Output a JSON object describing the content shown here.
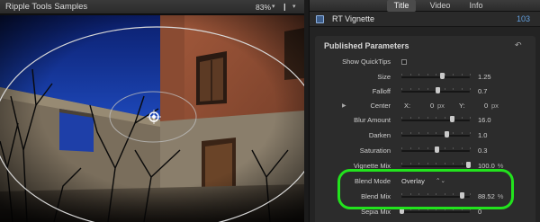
{
  "viewer": {
    "title": "Ripple Tools Samples",
    "zoom": "83%",
    "zoom_arrow": "▾",
    "view_icon": "❙",
    "view_arrow": "▾"
  },
  "inspector": {
    "tabs": [
      {
        "label": "Title",
        "active": true
      },
      {
        "label": "Video",
        "active": false
      },
      {
        "label": "Info",
        "active": false
      }
    ],
    "effect_icon": "filter-icon",
    "effect_name": "RT Vignette",
    "effect_count": "103",
    "section_title": "Published Parameters",
    "reset_icon": "reset-icon",
    "reset_glyph": "↶",
    "params": {
      "show_quicktips": {
        "label": "Show QuickTips",
        "checked": false
      },
      "size": {
        "label": "Size",
        "value": "1.25",
        "fraction": 0.59
      },
      "falloff": {
        "label": "Falloff",
        "value": "0.7",
        "fraction": 0.52
      },
      "center": {
        "label": "Center",
        "x_label": "X:",
        "x_value": "0",
        "x_unit": "px",
        "y_label": "Y:",
        "y_value": "0",
        "y_unit": "px",
        "disclosure": "▶"
      },
      "blur_amount": {
        "label": "Blur Amount",
        "value": "16.0",
        "fraction": 0.74
      },
      "darken": {
        "label": "Darken",
        "value": "1.0",
        "fraction": 0.66
      },
      "saturation": {
        "label": "Saturation",
        "value": "0.3",
        "fraction": 0.51
      },
      "vignette_mix": {
        "label": "Vignette Mix",
        "value": "100.0",
        "unit": "%",
        "fraction": 0.98
      },
      "blend_mode": {
        "label": "Blend Mode",
        "value": "Overlay",
        "arrows": "⌃⌄"
      },
      "blend_mix": {
        "label": "Blend Mix",
        "value": "88.52",
        "unit": "%",
        "fraction": 0.88
      },
      "sepia_mix": {
        "label": "Sepia Mix",
        "value": "0",
        "fraction": 0.0
      }
    }
  },
  "colors": {
    "highlight": "#22e31d",
    "accent_blue": "#62a0e0"
  }
}
